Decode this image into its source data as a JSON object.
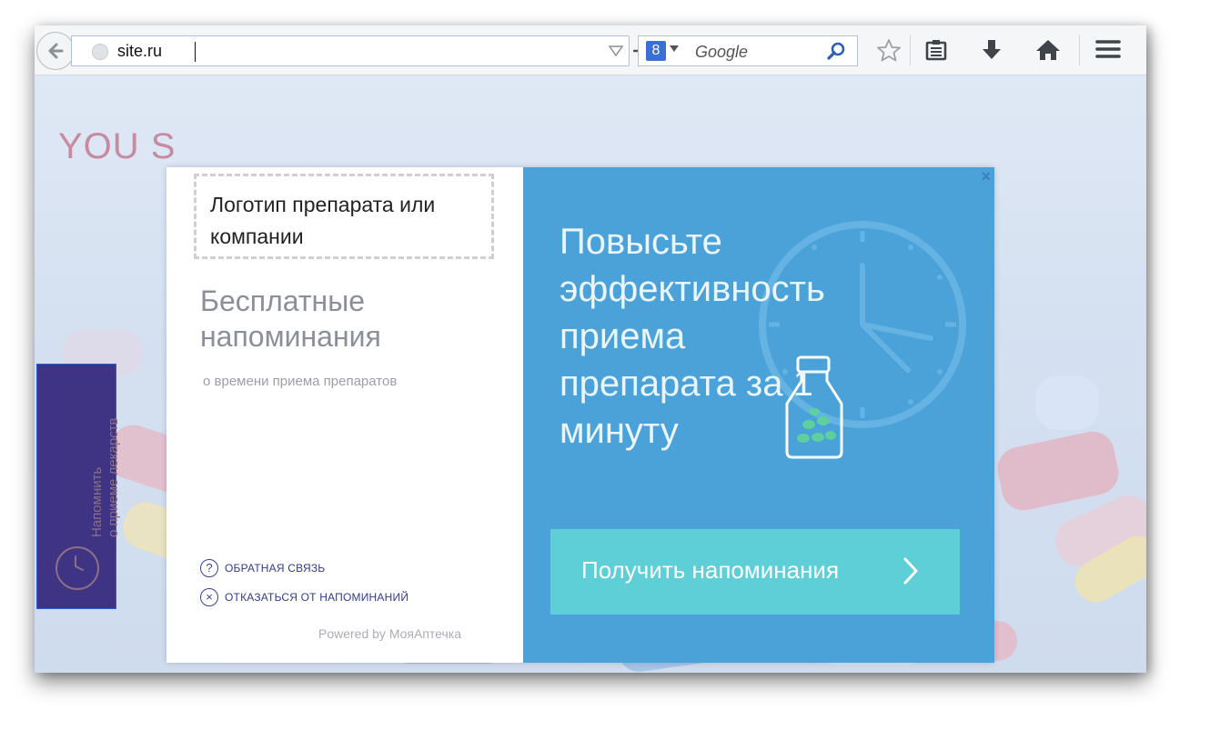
{
  "browser": {
    "url": "site.ru",
    "search_placeholder": "Google",
    "search_engine_glyph": "8",
    "icons": [
      "back-arrow-icon",
      "globe-icon",
      "dropdown-triangle-icon",
      "go-arrow-icon",
      "google-search-engine-icon",
      "magnifier-icon",
      "bookmark-star-icon",
      "reading-list-icon",
      "download-arrow-icon",
      "home-icon",
      "menu-icon"
    ]
  },
  "page": {
    "headline": "YOU S"
  },
  "side_tab": {
    "label_line1": "Напомнить",
    "label_line2": "о приеме лекарств"
  },
  "modal": {
    "logo_placeholder": "Логотип препарата или компании",
    "heading": "Бесплатные напоминания",
    "subheading": "о времени приема препаратов",
    "feedback_link": "ОБРАТНАЯ СВЯЗЬ",
    "unsubscribe_link": "ОТКАЗАТЬСЯ ОТ НАПОМИНАНИЙ",
    "powered_by": "Powered by МояАптечка",
    "close": "×",
    "promo_text": "Повысьте эффективность приема препарата за 1 минуту",
    "cta_label": "Получить напоминания",
    "colors": {
      "promo_bg": "#4aa2d9",
      "cta_bg": "#5ecfd6",
      "side_tab_bg": "#3f3384",
      "link": "#333a8f"
    }
  }
}
